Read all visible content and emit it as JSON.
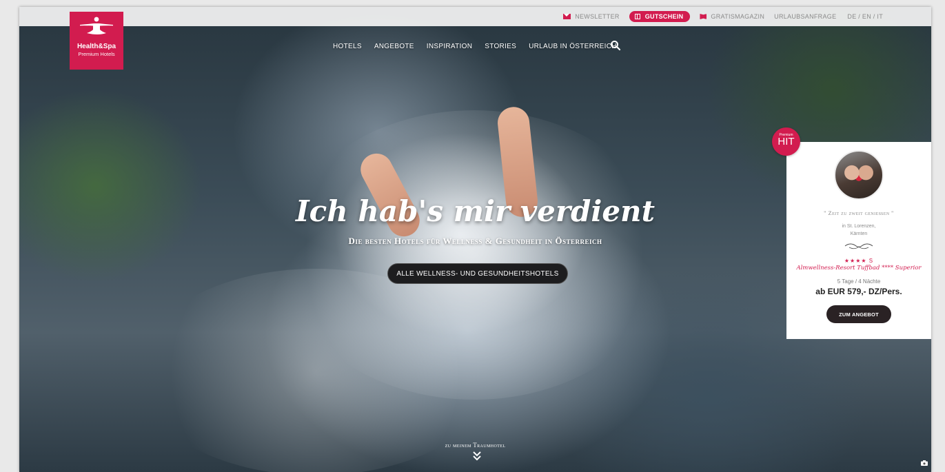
{
  "colors": {
    "brand": "#d21c4f",
    "button_dark": "#1d1d1f",
    "white": "#ffffff"
  },
  "logo": {
    "title": "Health&Spa",
    "subtitle": "Premium Hotels"
  },
  "topbar": {
    "newsletter": "NEWSLETTER",
    "voucher": "GUTSCHEIN",
    "magazine": "GRATISMAGAZIN",
    "request": "URLAUBSANFRAGE",
    "languages": "DE / EN / IT"
  },
  "nav": {
    "items": [
      "HOTELS",
      "ANGEBOTE",
      "INSPIRATION",
      "STORIES",
      "URLAUB IN ÖSTERREICH"
    ],
    "search_icon": "search-icon"
  },
  "hero": {
    "headline": "Ich hab's mir verdient",
    "subheadline": "Die besten Hotels für Wellness & Gesundheit in Österreich",
    "cta": "ALLE WELLNESS- UND GESUNDHEITSHOTELS",
    "scroll_label": "zu meinem Traumhotel"
  },
  "badge": {
    "small": "Premium",
    "big": "HIT"
  },
  "offer": {
    "quote": "\" Zeit zu zweit genießen \"",
    "place_line1": "in St. Lorenzen,",
    "place_line2": "Kärnten",
    "stars": "★★★★ S",
    "hotel": "Almwellness-Resort Tuffbad **** Superior",
    "duration": "5 Tage / 4 Nächte",
    "price": "ab EUR 579,- DZ/Pers.",
    "button": "ZUM ANGEBOT"
  }
}
